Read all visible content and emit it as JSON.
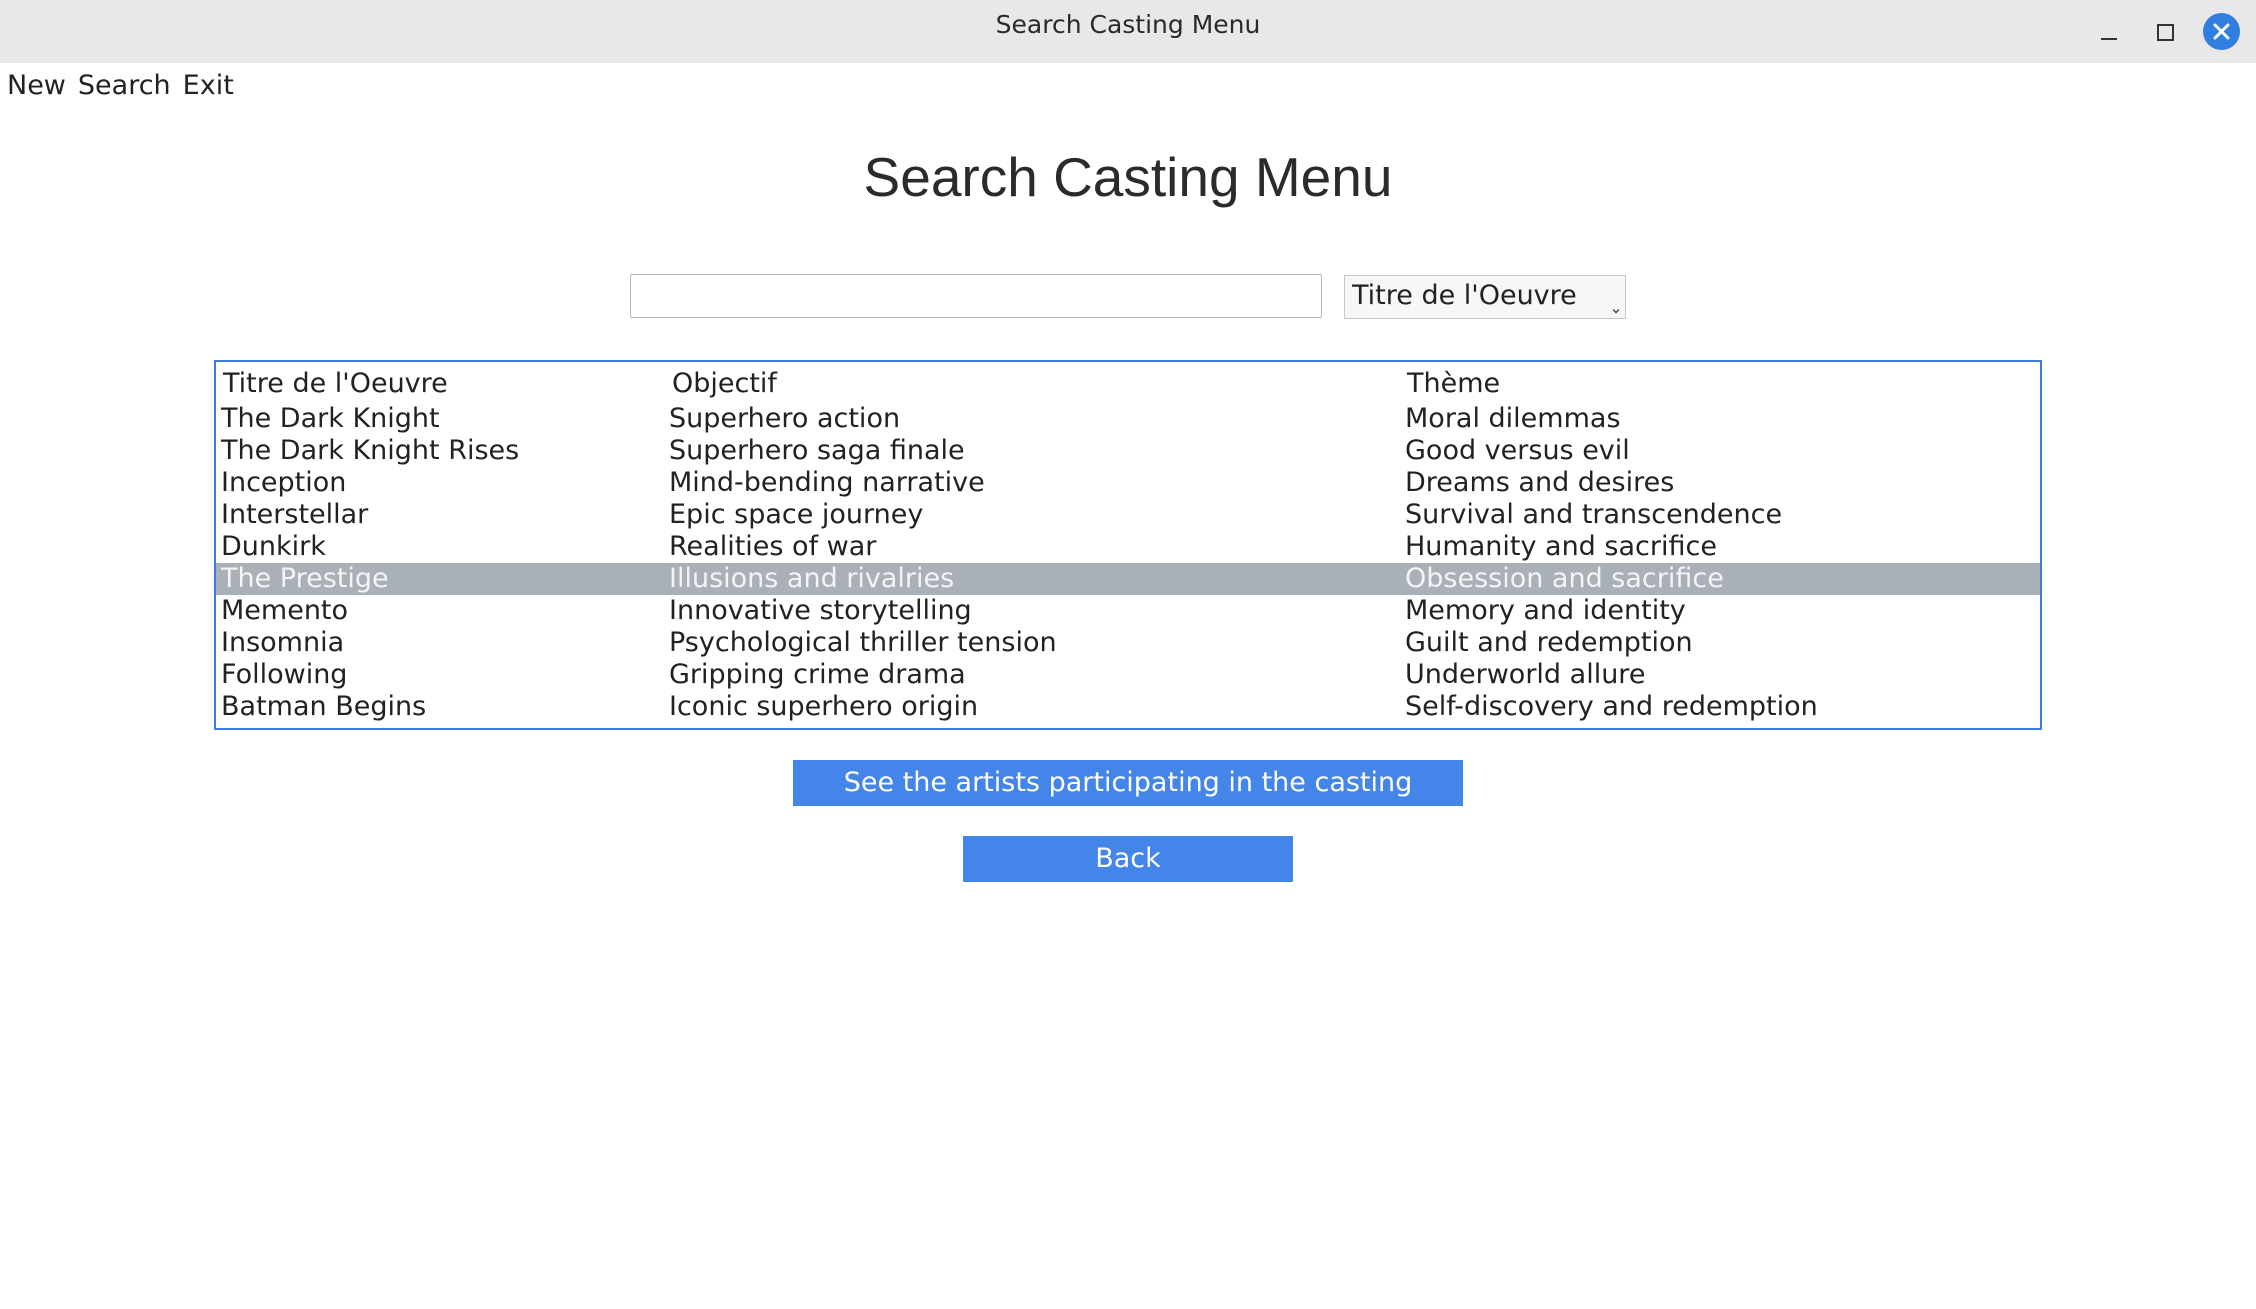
{
  "window": {
    "title": "Search Casting Menu"
  },
  "menu": {
    "items": [
      "New",
      "Search",
      "Exit"
    ]
  },
  "page": {
    "title": "Search Casting Menu"
  },
  "search": {
    "value": "",
    "placeholder": ""
  },
  "filter": {
    "selected": "Titre de l'Oeuvre"
  },
  "table": {
    "headers": [
      "Titre de l'Oeuvre",
      "Objectif",
      "Thème"
    ],
    "rows": [
      [
        "The Dark Knight",
        "Superhero action",
        "Moral dilemmas"
      ],
      [
        "The Dark Knight Rises",
        "Superhero saga finale",
        "Good versus evil"
      ],
      [
        "Inception",
        "Mind-bending narrative",
        "Dreams and desires"
      ],
      [
        "Interstellar",
        "Epic space journey",
        "Survival and transcendence"
      ],
      [
        "Dunkirk",
        "Realities of war",
        "Humanity and sacrifice"
      ],
      [
        "The Prestige",
        "Illusions and rivalries",
        "Obsession and sacrifice"
      ],
      [
        "Memento",
        "Innovative storytelling",
        "Memory and identity"
      ],
      [
        "Insomnia",
        "Psychological thriller tension",
        "Guilt and redemption"
      ],
      [
        "Following",
        "Gripping crime drama",
        "Underworld allure"
      ],
      [
        "Batman Begins",
        "Iconic superhero origin",
        "Self-discovery and redemption"
      ]
    ],
    "selected_row": 5
  },
  "buttons": {
    "artists": "See the artists participating in the casting",
    "back": "Back"
  },
  "colors": {
    "accent": "#4485e9",
    "selection": "#aab0b8",
    "close": "#2f7ee0"
  }
}
